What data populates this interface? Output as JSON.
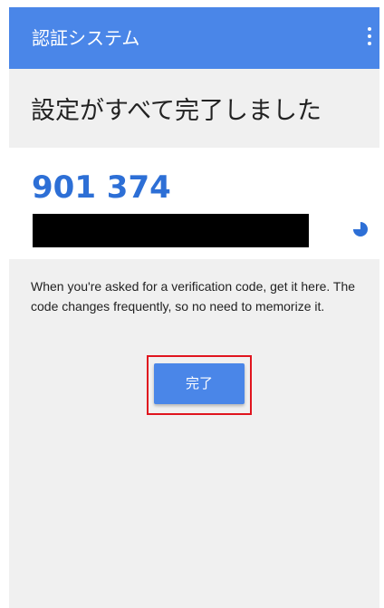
{
  "app_bar": {
    "title": "認証システム",
    "menu_icon": "more-vert-icon"
  },
  "heading": "設定がすべて完了しました",
  "code_card": {
    "code": "901 374",
    "timer_icon": "countdown-pie-icon"
  },
  "description": "When you're asked for a verification code, get it here. The code changes frequently, so no need to memorize it.",
  "done_button": {
    "label": "完了"
  },
  "colors": {
    "app_bar": "#4a86e8",
    "code_text": "#2d6fd6",
    "button": "#4a86e8",
    "highlight_border": "#e0141e",
    "background": "#f0f0f0"
  }
}
